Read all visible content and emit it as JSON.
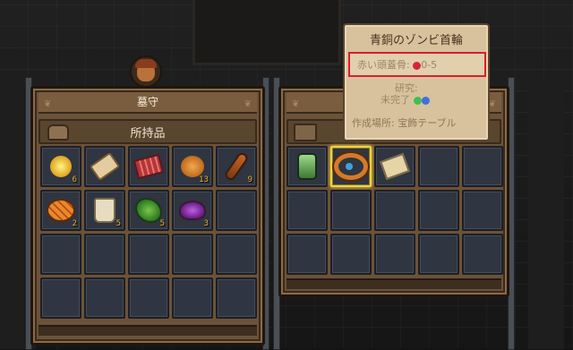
{
  "left_panel": {
    "owner_name": "墓守",
    "section_title": "所持品",
    "items": [
      {
        "icon": "gold-coin-icon",
        "qty": "6"
      },
      {
        "icon": "scroll-icon",
        "qty": ""
      },
      {
        "icon": "meat-slab-icon",
        "qty": ""
      },
      {
        "icon": "bread-icon",
        "qty": "13"
      },
      {
        "icon": "kebab-icon",
        "qty": "9"
      },
      {
        "icon": "pie-icon",
        "qty": "2"
      },
      {
        "icon": "cup-icon",
        "qty": "5"
      },
      {
        "icon": "herb-icon",
        "qty": "5"
      },
      {
        "icon": "potion-bowl-icon",
        "qty": "3"
      }
    ]
  },
  "right_panel": {
    "items": [
      {
        "icon": "green-jar-icon"
      },
      {
        "icon": "bronze-collar-icon"
      },
      {
        "icon": "paper-note-icon"
      }
    ]
  },
  "tooltip": {
    "title": "青銅のゾンビ首輪",
    "requirement": "赤い頭蓋骨: ",
    "requirement_range": "0-5",
    "research_label": "研究:",
    "research_status": "未完了",
    "craft_place": "作成場所: 宝飾テーブル"
  },
  "colors": {
    "panel_brown": "#6b5238",
    "slot_blue": "#2f3541",
    "selected_gold": "#f0d23a",
    "quantity_orange": "#f0b12f",
    "highlight_red": "#d81e2e",
    "gem_red": "#d6263a",
    "gem_green": "#3fbf52",
    "gem_blue": "#3f6fe0"
  }
}
